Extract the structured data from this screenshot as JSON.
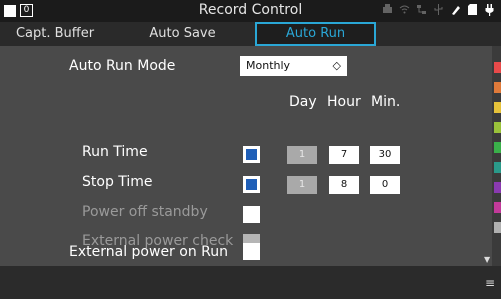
{
  "window": {
    "title": "Record Control",
    "indicator_value": "0"
  },
  "status_icons": [
    "printer-icon",
    "wifi-icon",
    "network-icon",
    "usb-icon",
    "pen-icon",
    "sd-card-icon",
    "power-plug-icon"
  ],
  "tabs": [
    {
      "label": "Capt. Buffer",
      "active": false
    },
    {
      "label": "Auto Save",
      "active": false
    },
    {
      "label": "Auto Run",
      "active": true
    }
  ],
  "auto_run": {
    "mode_label": "Auto Run Mode",
    "mode_value": "Monthly",
    "columns": {
      "day": "Day",
      "hour": "Hour",
      "min": "Min."
    },
    "run_time": {
      "label": "Run Time",
      "checked": true,
      "day": "1",
      "hour": "7",
      "min": "30"
    },
    "stop_time": {
      "label": "Stop Time",
      "checked": true,
      "day": "1",
      "hour": "8",
      "min": "0"
    },
    "power_off_standby": {
      "label": "Power off standby",
      "enabled": false
    },
    "external_power_check": {
      "label": "External power check",
      "enabled": false
    },
    "external_power_on_run": {
      "label": "External power on Run",
      "checked": false
    }
  },
  "colors": {
    "accent": "#2aa7d6",
    "channel_chips": [
      "#e84a4a",
      "#e07a3a",
      "#e6c23a",
      "#9ac23a",
      "#3ab04a",
      "#2a9a8a",
      "#8a3ab0",
      "#c23a9a",
      "#b0b0b0"
    ]
  }
}
